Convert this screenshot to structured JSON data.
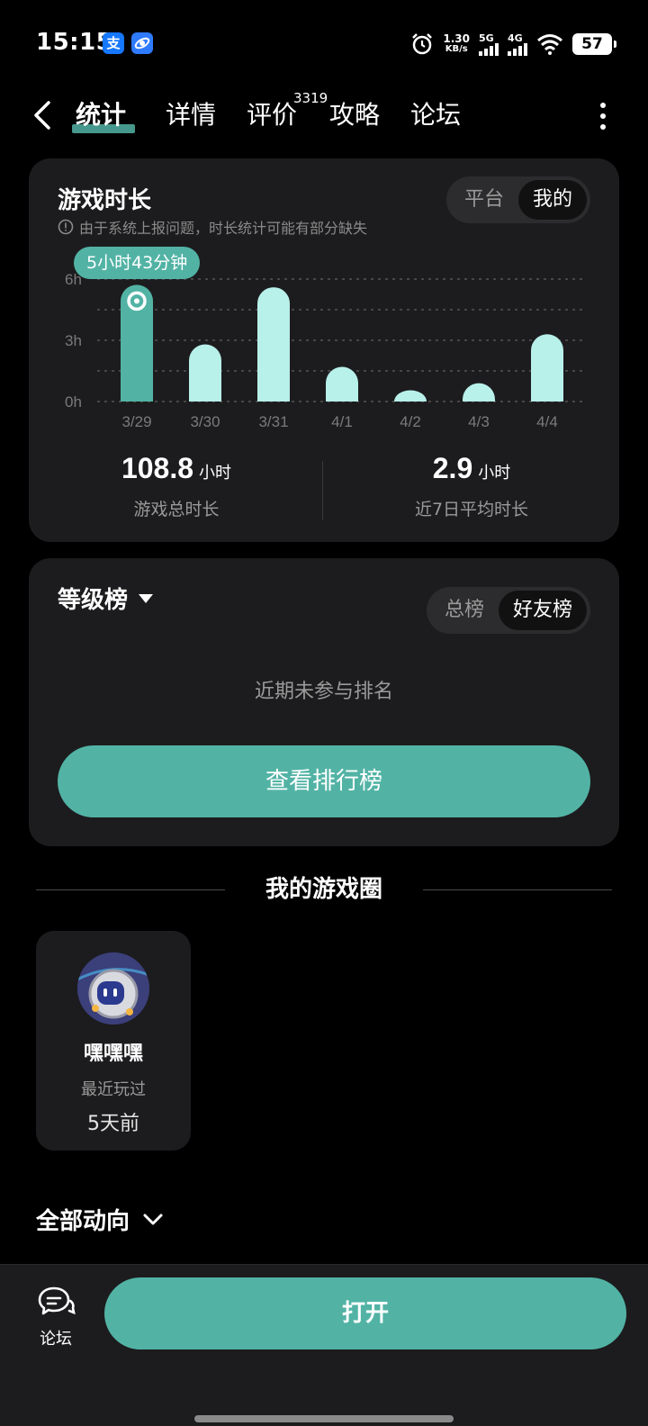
{
  "status_bar": {
    "time": "15:15",
    "app_icons": [
      "alipay-icon",
      "browser-icon"
    ],
    "net_speed_value": "1.30",
    "net_speed_unit": "KB/s",
    "sim1": "5G",
    "sim2": "4G",
    "battery": "57"
  },
  "nav": {
    "tabs": [
      {
        "label": "统计",
        "active": true
      },
      {
        "label": "详情",
        "active": false
      },
      {
        "label": "评价",
        "active": false
      },
      {
        "label": "攻略",
        "active": false
      },
      {
        "label": "论坛",
        "active": false
      }
    ],
    "review_count": "3319",
    "accent": "#52b3a5"
  },
  "playtime": {
    "title": "游戏时长",
    "note": "由于系统上报问题，时长统计可能有部分缺失",
    "segment": {
      "options": [
        "平台",
        "我的"
      ],
      "selected": "我的"
    },
    "tooltip": "5小时43分钟",
    "total_value": "108.8",
    "total_unit": "小时",
    "total_label": "游戏总时长",
    "avg_value": "2.9",
    "avg_unit": "小时",
    "avg_label": "近7日平均时长"
  },
  "chart_data": {
    "type": "bar",
    "categories": [
      "3/29",
      "3/30",
      "3/31",
      "4/1",
      "4/2",
      "4/3",
      "4/4"
    ],
    "values": [
      5.72,
      2.8,
      5.6,
      1.7,
      0.55,
      0.9,
      3.3
    ],
    "highlighted_index": 0,
    "y_ticks": [
      "6h",
      "3h",
      "0h"
    ],
    "ylim": [
      0,
      6
    ],
    "grid": true,
    "colors": {
      "highlight": "#52b3a5",
      "bar": "#b8f0ea"
    }
  },
  "ranking": {
    "title": "等级榜",
    "segment": {
      "options": [
        "总榜",
        "好友榜"
      ],
      "selected": "好友榜"
    },
    "empty_text": "近期未参与排名",
    "button": "查看排行榜"
  },
  "circle": {
    "section_title": "我的游戏圈",
    "name": "嘿嘿嘿",
    "sub": "最近玩过",
    "ago": "5天前"
  },
  "feed": {
    "title": "全部动向"
  },
  "bottom_bar": {
    "forum_label": "论坛",
    "open_button": "打开"
  }
}
